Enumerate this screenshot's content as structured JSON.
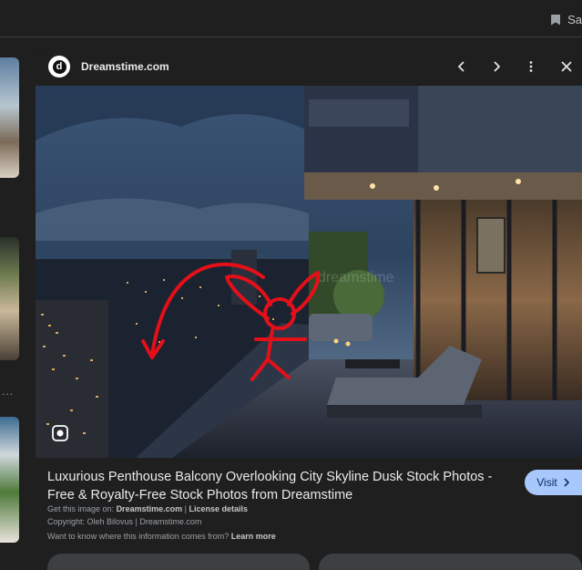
{
  "topbar": {
    "saved_label": "Sa"
  },
  "left_thumbnails": {
    "more_label": "..."
  },
  "panel": {
    "site_name": "Dreamstime.com",
    "logo_letter": "d",
    "image_alt": "Luxurious penthouse balcony overlooking city skyline at dusk",
    "title": "Luxurious Penthouse Balcony Overlooking City Skyline Dusk Stock Photos - Free & Royalty-Free Stock Photos from Dreamstime",
    "visit_label": "Visit",
    "get_image_prefix": "Get this image on:",
    "get_image_site": "Dreamstime.com",
    "separator": "|",
    "license_label": "License details",
    "copyright": "Copyright: Oleh Bilovus | Dreamstime.com",
    "source_question": "Want to know where this information comes from?",
    "learn_more": "Learn more",
    "watermark": "dreamstime"
  },
  "colors": {
    "accent": "#a8c7fa",
    "background": "#1f1f1f",
    "annotation": "#e3101a"
  },
  "icons": [
    "chevron-left-icon",
    "chevron-right-icon",
    "more-vert-icon",
    "close-icon",
    "lens-icon",
    "bookmark-icon",
    "external-arrow-icon"
  ]
}
